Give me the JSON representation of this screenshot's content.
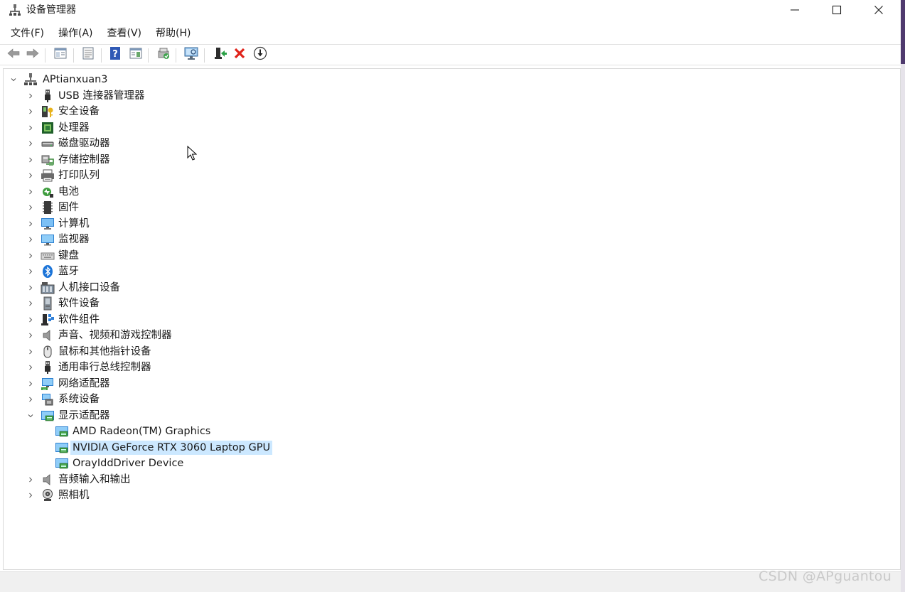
{
  "window": {
    "title": "设备管理器",
    "minimize_icon": "minimize-icon",
    "maximize_icon": "maximize-icon",
    "close_icon": "close-icon"
  },
  "menu": [
    "文件(F)",
    "操作(A)",
    "查看(V)",
    "帮助(H)"
  ],
  "toolbar": [
    "back-arrow-icon",
    "forward-arrow-icon",
    "show-hide-tree-icon",
    "properties-icon",
    "help-icon",
    "action-pane-icon",
    "update-driver-icon",
    "scan-hardware-icon",
    "enable-device-icon",
    "uninstall-device-icon",
    "download-driver-icon"
  ],
  "tree": {
    "root": "APtianxuan3",
    "categories": [
      {
        "label": "USB 连接器管理器",
        "icon": "usb-connector-icon",
        "expanded": false
      },
      {
        "label": "安全设备",
        "icon": "security-key-icon",
        "expanded": false
      },
      {
        "label": "处理器",
        "icon": "processor-icon",
        "expanded": false
      },
      {
        "label": "磁盘驱动器",
        "icon": "disk-drive-icon",
        "expanded": false
      },
      {
        "label": "存储控制器",
        "icon": "storage-controller-icon",
        "expanded": false
      },
      {
        "label": "打印队列",
        "icon": "printer-icon",
        "expanded": false
      },
      {
        "label": "电池",
        "icon": "battery-icon",
        "expanded": false
      },
      {
        "label": "固件",
        "icon": "firmware-icon",
        "expanded": false
      },
      {
        "label": "计算机",
        "icon": "computer-icon",
        "expanded": false
      },
      {
        "label": "监视器",
        "icon": "monitor-icon",
        "expanded": false
      },
      {
        "label": "键盘",
        "icon": "keyboard-icon",
        "expanded": false
      },
      {
        "label": "蓝牙",
        "icon": "bluetooth-icon",
        "expanded": false
      },
      {
        "label": "人机接口设备",
        "icon": "hid-icon",
        "expanded": false
      },
      {
        "label": "软件设备",
        "icon": "software-device-icon",
        "expanded": false
      },
      {
        "label": "软件组件",
        "icon": "software-component-icon",
        "expanded": false
      },
      {
        "label": "声音、视频和游戏控制器",
        "icon": "speaker-icon",
        "expanded": false
      },
      {
        "label": "鼠标和其他指针设备",
        "icon": "mouse-icon",
        "expanded": false
      },
      {
        "label": "通用串行总线控制器",
        "icon": "usb-controller-icon",
        "expanded": false
      },
      {
        "label": "网络适配器",
        "icon": "network-adapter-icon",
        "expanded": false
      },
      {
        "label": "系统设备",
        "icon": "system-device-icon",
        "expanded": false
      },
      {
        "label": "显示适配器",
        "icon": "display-adapter-icon",
        "expanded": true,
        "children": [
          {
            "label": "AMD Radeon(TM) Graphics",
            "icon": "display-adapter-icon",
            "selected": false
          },
          {
            "label": "NVIDIA GeForce RTX 3060 Laptop GPU",
            "icon": "display-adapter-icon",
            "selected": true
          },
          {
            "label": "OrayIddDriver Device",
            "icon": "display-adapter-icon",
            "selected": false
          }
        ]
      },
      {
        "label": "音频输入和输出",
        "icon": "speaker-icon",
        "expanded": false
      },
      {
        "label": "照相机",
        "icon": "camera-icon",
        "expanded": false
      }
    ]
  },
  "watermark": "CSDN @APguantou",
  "colors": {
    "selection": "#cce8ff",
    "accent": "#0b6fd6"
  }
}
